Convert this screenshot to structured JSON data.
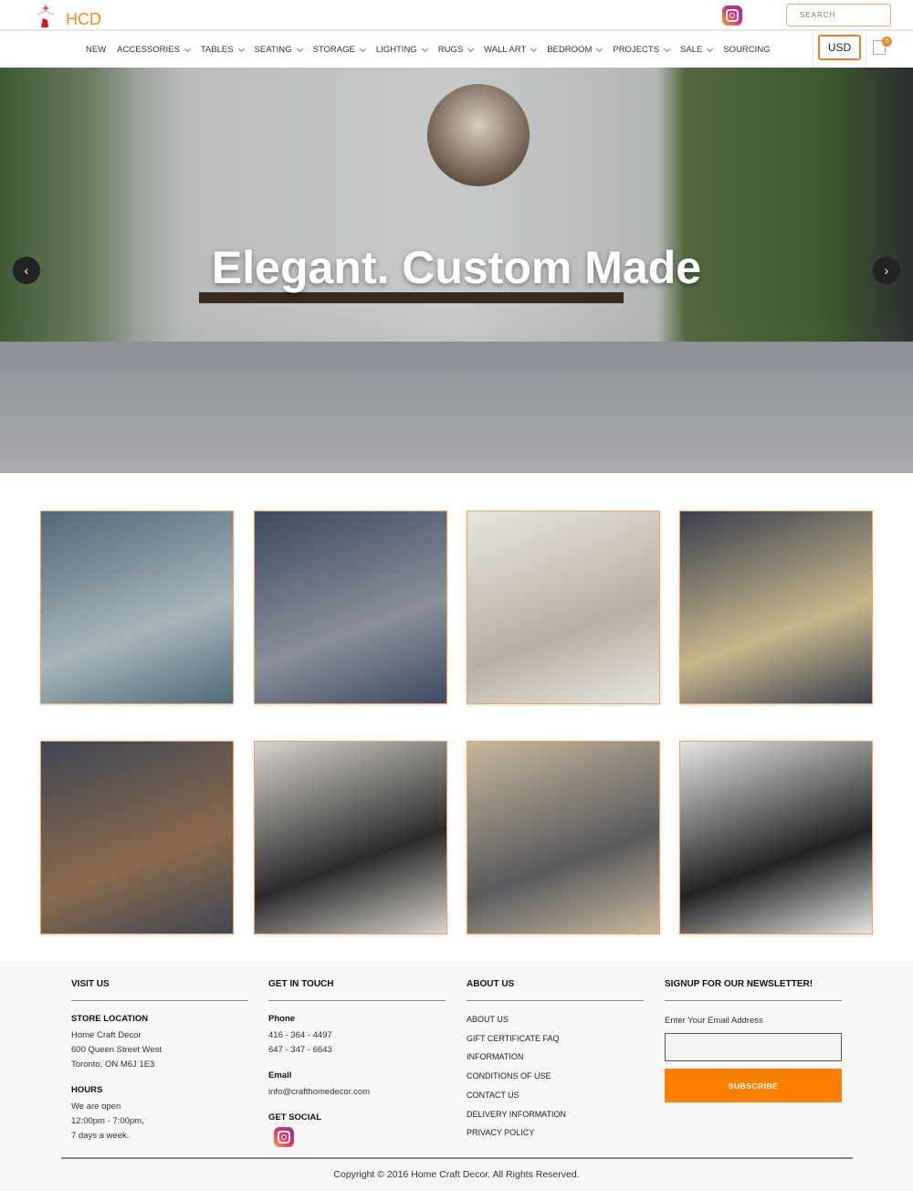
{
  "header": {
    "logo_text": "HCD",
    "search_placeholder": "SEARCH",
    "currency": "USD",
    "cart_count": "0",
    "social_icon": "instagram-icon"
  },
  "nav": {
    "items": [
      {
        "label": "NEW",
        "dropdown": false
      },
      {
        "label": "ACCESSORIES",
        "dropdown": true
      },
      {
        "label": "TABLES",
        "dropdown": true
      },
      {
        "label": "SEATING",
        "dropdown": true
      },
      {
        "label": "STORAGE",
        "dropdown": true
      },
      {
        "label": "LIGHTING",
        "dropdown": true
      },
      {
        "label": "RUGS",
        "dropdown": true
      },
      {
        "label": "WALL ART",
        "dropdown": true
      },
      {
        "label": "BEDROOM",
        "dropdown": true
      },
      {
        "label": "PROJECTS",
        "dropdown": true
      },
      {
        "label": "SALE",
        "dropdown": true
      },
      {
        "label": "SOURCING",
        "dropdown": false
      }
    ]
  },
  "hero": {
    "title": "Elegant. Custom Made",
    "prev": "‹",
    "next": "›"
  },
  "tiles": [
    {
      "name": "sculptures",
      "c1": "#4e6a7a",
      "c2": "#a7b5bb"
    },
    {
      "name": "blue-armchair",
      "c1": "#3d4a63",
      "c2": "#8a8f99"
    },
    {
      "name": "chandelier",
      "c1": "#e8e4de",
      "c2": "#b8b0a4"
    },
    {
      "name": "mirror-wall",
      "c1": "#3a3f4f",
      "c2": "#c9b78a"
    },
    {
      "name": "wood-table",
      "c1": "#3f4656",
      "c2": "#8a6a4a"
    },
    {
      "name": "bedroom",
      "c1": "#d8d4ce",
      "c2": "#2b2b2b"
    },
    {
      "name": "living-room",
      "c1": "#c8b89a",
      "c2": "#5a5a5e"
    },
    {
      "name": "dining-set",
      "c1": "#e6e6e4",
      "c2": "#222222"
    }
  ],
  "footer": {
    "visit": {
      "heading": "VISIT US",
      "store_label": "STORE LOCATION",
      "address": [
        "Home Craft Decor",
        "600 Queen Street West",
        "Toronto, ON M6J 1E3"
      ],
      "hours_label": "HOURS",
      "hours": [
        "We are open",
        "12:00pm - 7:00pm,",
        "7 days a week."
      ]
    },
    "contact": {
      "heading": "GET IN TOUCH",
      "phone_label": "Phone",
      "phones": [
        "416 - 364 - 4497",
        "647 - 347 - 6643"
      ],
      "email_label": "Email",
      "email": "info@crafthomedecor.com",
      "social_label": "GET SOCIAL"
    },
    "about": {
      "heading": "ABOUT US",
      "links": [
        "ABOUT US",
        "GIFT CERTIFICATE FAQ",
        "INFORMATION",
        "CONDITIONS OF USE",
        "CONTACT US",
        "DELIVERY INFORMATION",
        "PRIVACY POLICY"
      ]
    },
    "newsletter": {
      "heading": "SIGNUP FOR OUR NEWSLETTER!",
      "label": "Enter Your Email Address",
      "button": "SUBSCRIBE"
    },
    "copyright": "Copyright © 2016 Home Craft Decor. All Rights Reserved."
  },
  "colors": {
    "accent": "#ff7f00",
    "border_accent": "#f0a460"
  }
}
